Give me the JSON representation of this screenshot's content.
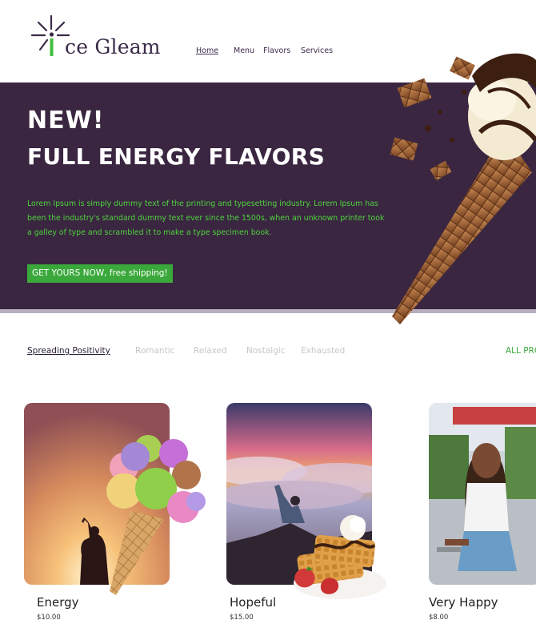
{
  "brand": {
    "logo_text": "ce Gleam",
    "logo_icon": "sparkle-i-icon"
  },
  "nav": {
    "items": [
      "Home",
      "Menu",
      "Flavors",
      "Services"
    ],
    "active": "Home"
  },
  "hero": {
    "kicker": "NEW!",
    "title": "FULL ENERGY FLAVORS",
    "body": "Lorem Ipsum is simply dummy text of the printing and typesetting industry. Lorem Ipsum has been the industry's standard dummy text ever since the 1500s, when an unknown printer took a galley of type and scrambled it to make a type specimen book.",
    "cta": "GET YOURS NOW, free shipping!",
    "image": "chocolate-cone-icon"
  },
  "filters": {
    "items": [
      "Spreading Positivity",
      "Romantic",
      "Relaxed",
      "Nostalgic",
      "Exhausted"
    ],
    "active": "Spreading Positivity",
    "all_label": "ALL PRO"
  },
  "products": [
    {
      "name": "Energy",
      "price": "$10.00",
      "image": "ice-cream-cone-scoops-icon"
    },
    {
      "name": "Hopeful",
      "price": "$15.00",
      "image": "waffle-strawberry-icon"
    },
    {
      "name": "Very Happy",
      "price": "$8.00",
      "image": "happy-woman-photo"
    }
  ],
  "colors": {
    "hero_bg": "#3a2640",
    "accent_green": "#3aa83a",
    "hero_text_green": "#4fd23e"
  }
}
